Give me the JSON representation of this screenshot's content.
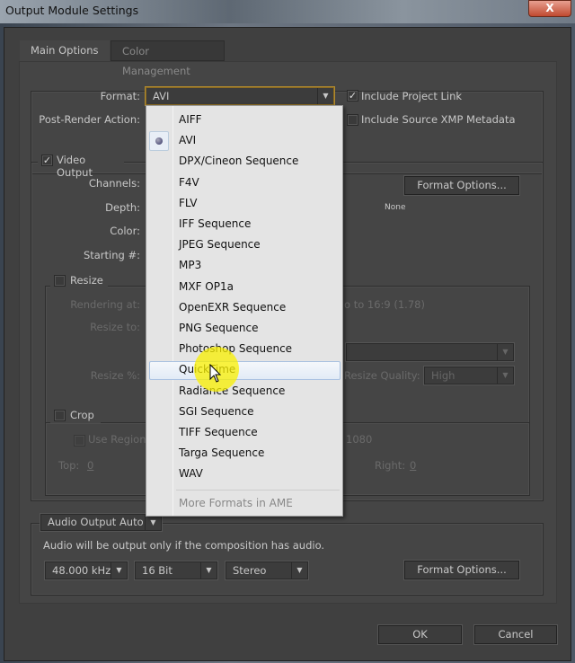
{
  "window": {
    "title": "Output Module Settings",
    "close_label": "X"
  },
  "tabs": [
    {
      "label": "Main Options",
      "active": true
    },
    {
      "label": "Color Management",
      "active": false
    }
  ],
  "format": {
    "label": "Format:",
    "value": "AVI",
    "post_render_label": "Post-Render Action:",
    "include_project_link": {
      "label": "Include Project Link",
      "checked": true
    },
    "include_xmp": {
      "label": "Include Source XMP Metadata",
      "checked": false
    }
  },
  "video": {
    "label": "Video Output",
    "checked": true,
    "channels_label": "Channels:",
    "depth_label": "Depth:",
    "color_label": "Color:",
    "starting_label": "Starting #:",
    "format_options": "Format Options...",
    "compression": "None"
  },
  "resize": {
    "label": "Resize",
    "checked": false,
    "aspect_text": "o to 16:9 (1.78)",
    "rendering_label": "Rendering at:",
    "resize_to_label": "Resize to:",
    "resize_pct_label": "Resize %:",
    "quality_label": "Resize Quality:",
    "quality_value": "High"
  },
  "crop": {
    "label": "Crop",
    "checked": false,
    "use_region_label": "Use Region",
    "size_text": "1080",
    "top_label": "Top:",
    "top_value": "0",
    "right_label": "Right:",
    "right_value": "0"
  },
  "audio": {
    "mode": "Audio Output Auto",
    "note": "Audio will be output only if the composition has audio.",
    "rate": "48.000 kHz",
    "bits": "16 Bit",
    "channels": "Stereo",
    "format_options": "Format Options..."
  },
  "buttons": {
    "ok": "OK",
    "cancel": "Cancel"
  },
  "dropdown": {
    "items": [
      "AIFF",
      "AVI",
      "DPX/Cineon Sequence",
      "F4V",
      "FLV",
      "IFF Sequence",
      "JPEG Sequence",
      "MP3",
      "MXF OP1a",
      "OpenEXR Sequence",
      "PNG Sequence",
      "Photoshop Sequence",
      "QuickTime",
      "Radiance Sequence",
      "SGI Sequence",
      "TIFF Sequence",
      "Targa Sequence",
      "WAV"
    ],
    "selected": "AVI",
    "hovered": "QuickTime",
    "more": "More Formats in AME"
  },
  "colors": {
    "dialog_bg": "#404040",
    "highlight": "#f5ea00",
    "menu_bg": "#e4e4e4"
  }
}
